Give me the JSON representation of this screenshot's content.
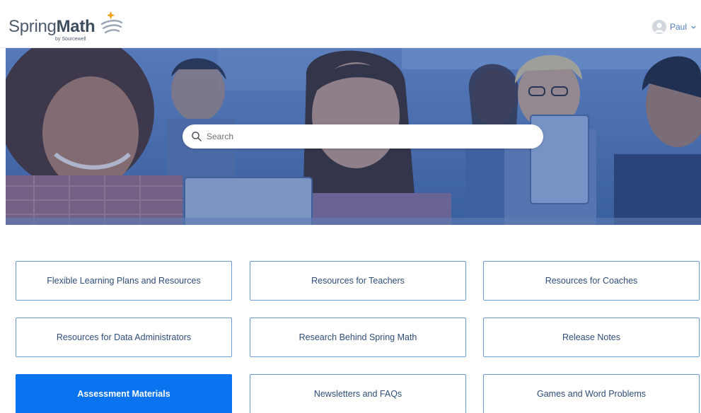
{
  "header": {
    "logo": {
      "word_light": "Spring",
      "word_bold": "Math",
      "subtitle": "by Sourcewell",
      "icon": "swoosh-star-logo-icon"
    },
    "user": {
      "name": "Paul",
      "avatar_icon": "user-avatar-icon",
      "caret_icon": "chevron-down-icon"
    }
  },
  "hero": {
    "search": {
      "placeholder": "Search",
      "value": "",
      "icon": "search-icon"
    }
  },
  "tiles": [
    {
      "label": "Flexible Learning Plans and Resources",
      "active": false
    },
    {
      "label": "Resources for Teachers",
      "active": false
    },
    {
      "label": "Resources for Coaches",
      "active": false
    },
    {
      "label": "Resources for Data Administrators",
      "active": false
    },
    {
      "label": "Research Behind Spring Math",
      "active": false
    },
    {
      "label": "Release Notes",
      "active": false
    },
    {
      "label": "Assessment Materials",
      "active": true
    },
    {
      "label": "Newsletters and FAQs",
      "active": false
    },
    {
      "label": "Games and Word Problems",
      "active": false
    }
  ],
  "colors": {
    "accent": "#0a73f0",
    "tile_border": "#6b9bd2",
    "tile_text": "#2f4d78",
    "hero_tint": "#2d4f8f"
  }
}
